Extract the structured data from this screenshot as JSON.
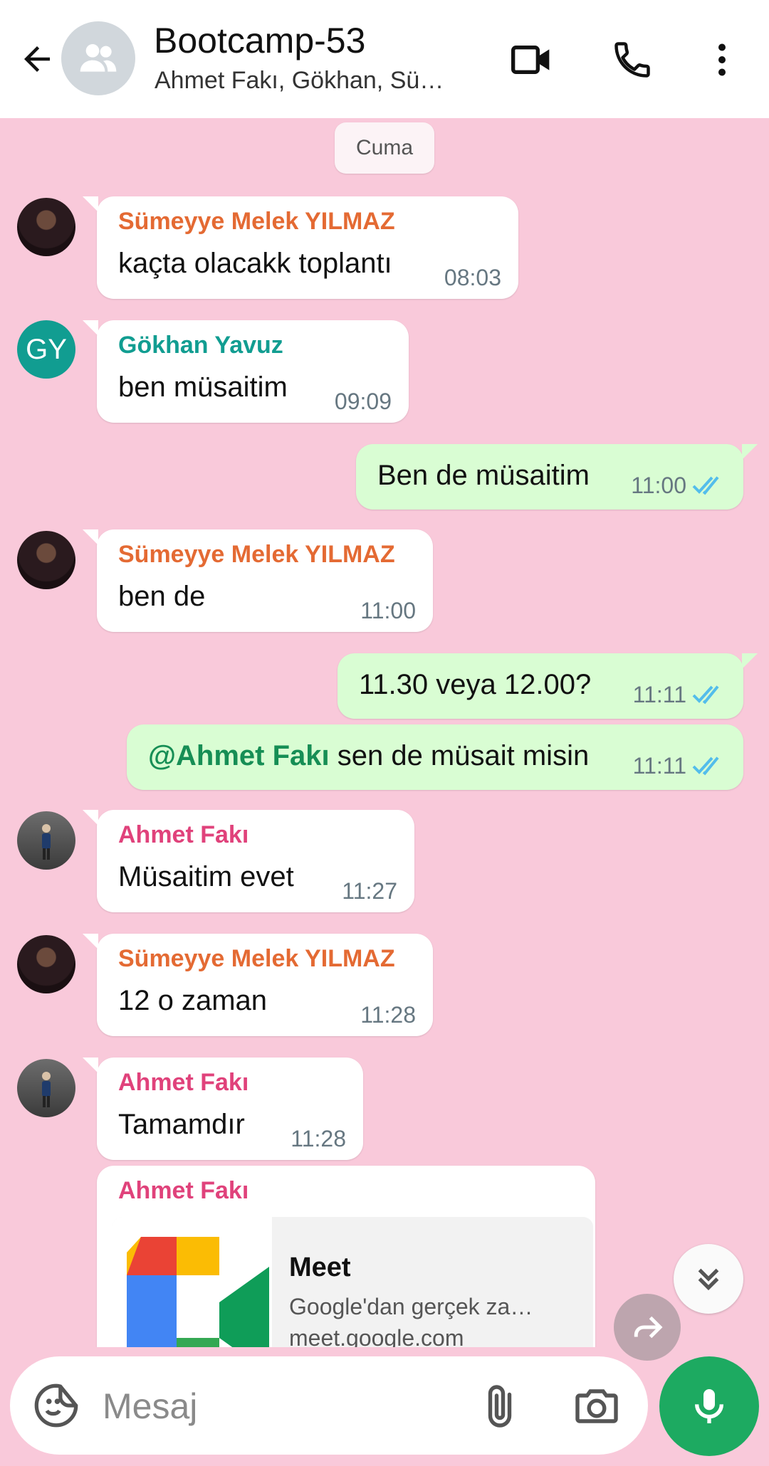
{
  "header": {
    "title": "Bootcamp-53",
    "subtitle": "Ahmet Fakı, Gökhan, Sü…"
  },
  "chat": {
    "date_chip": "Cuma",
    "messages": [
      {
        "sender": "Sümeyye Melek YILMAZ",
        "sender_color": "#e46a33",
        "text": "kaçta olacakk toplantı",
        "time": "08:03"
      },
      {
        "sender": "Gökhan Yavuz",
        "sender_color": "#119d91",
        "avatar_initials": "GY",
        "text": "ben müsaitim",
        "time": "09:09"
      },
      {
        "text": "Ben de müsaitim",
        "time": "11:00",
        "status": "read"
      },
      {
        "sender": "Sümeyye Melek YILMAZ",
        "sender_color": "#e46a33",
        "text": "ben de",
        "time": "11:00"
      },
      {
        "text": "11.30 veya 12.00?",
        "time": "11:11",
        "status": "read"
      },
      {
        "mention": "@Ahmet Fakı",
        "text": " sen de müsait misin",
        "time": "11:11",
        "status": "read"
      },
      {
        "sender": "Ahmet Fakı",
        "sender_color": "#e0427b",
        "text": "Müsaitim evet",
        "time": "11:27"
      },
      {
        "sender": "Sümeyye Melek YILMAZ",
        "sender_color": "#e46a33",
        "text": "12 o zaman",
        "time": "11:28"
      },
      {
        "sender": "Ahmet Fakı",
        "sender_color": "#e0427b",
        "text": "Tamamdır",
        "time": "11:28"
      },
      {
        "sender": "Ahmet Fakı",
        "sender_color": "#e0427b",
        "link_preview": {
          "title": "Meet",
          "description": "Google'dan gerçek za…",
          "domain": "meet.google.com"
        }
      }
    ]
  },
  "composer": {
    "placeholder": "Mesaj"
  },
  "colors": {
    "chat_background": "#f9c9da",
    "outgoing_bubble": "#d9fdd3",
    "read_ticks": "#53bdeb",
    "mic_button": "#1daa61"
  },
  "icons": [
    "back-arrow-icon",
    "group-icon",
    "video-call-icon",
    "phone-icon",
    "more-vert-icon",
    "double-check-icon",
    "chevrons-down-icon",
    "forward-icon",
    "sticker-icon",
    "paperclip-icon",
    "camera-icon",
    "mic-icon"
  ]
}
